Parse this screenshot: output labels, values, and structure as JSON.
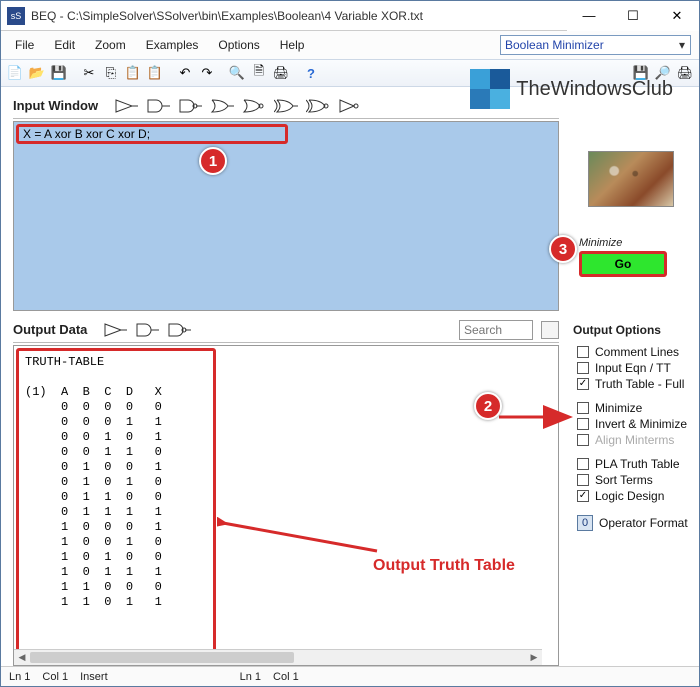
{
  "window": {
    "app_icon": "sS",
    "title": "BEQ - C:\\SimpleSolver\\SSolver\\bin\\Examples\\Boolean\\4 Variable XOR.txt",
    "minimize": "—",
    "maximize": "☐",
    "close": "✕"
  },
  "menu": {
    "file": "File",
    "edit": "Edit",
    "zoom": "Zoom",
    "examples": "Examples",
    "options": "Options",
    "help": "Help",
    "mode": "Boolean Minimizer"
  },
  "toolbar_icons": [
    "new",
    "open",
    "save",
    "cut",
    "copy",
    "paste",
    "paste2",
    "undo",
    "redo",
    "find",
    "preview",
    "print",
    "help",
    "disk",
    "doc-find",
    "printer"
  ],
  "logo_text": "TheWindowsClub",
  "input": {
    "pane_title": "Input Window",
    "equation": "X = A xor B xor C xor D;"
  },
  "minimize": {
    "label": "Minimize",
    "go": "Go"
  },
  "output": {
    "pane_title": "Output Data",
    "search_placeholder": "Search",
    "text": "TRUTH-TABLE\n\n(1)  A  B  C  D   X\n     0  0  0  0   0\n     0  0  0  1   1\n     0  0  1  0   1\n     0  0  1  1   0\n     0  1  0  0   1\n     0  1  0  1   0\n     0  1  1  0   0\n     0  1  1  1   1\n     1  0  0  0   1\n     1  0  0  1   0\n     1  0  1  0   0\n     1  0  1  1   1\n     1  1  0  0   0\n     1  1  0  1   1"
  },
  "options": {
    "title": "Output Options",
    "items": [
      {
        "label": "Comment Lines",
        "checked": false,
        "disabled": false
      },
      {
        "label": "Input Eqn / TT",
        "checked": false,
        "disabled": false
      },
      {
        "label": "Truth Table - Full",
        "checked": true,
        "disabled": false
      },
      {
        "label": "Minimize",
        "checked": false,
        "disabled": false
      },
      {
        "label": "Invert & Minimize",
        "checked": false,
        "disabled": false
      },
      {
        "label": "Align Minterms",
        "checked": false,
        "disabled": true
      },
      {
        "label": "PLA Truth Table",
        "checked": false,
        "disabled": false
      },
      {
        "label": "Sort Terms",
        "checked": false,
        "disabled": false
      },
      {
        "label": "Logic Design",
        "checked": true,
        "disabled": false
      }
    ],
    "opfmt_val": "0",
    "opfmt_label": "Operator Format"
  },
  "status": {
    "a": "Ln 1",
    "b": "Col 1",
    "c": "Insert",
    "d": "Ln 1",
    "e": "Col 1"
  },
  "annotations": {
    "b1": "1",
    "b2": "2",
    "b3": "3",
    "label": "Output Truth Table"
  }
}
